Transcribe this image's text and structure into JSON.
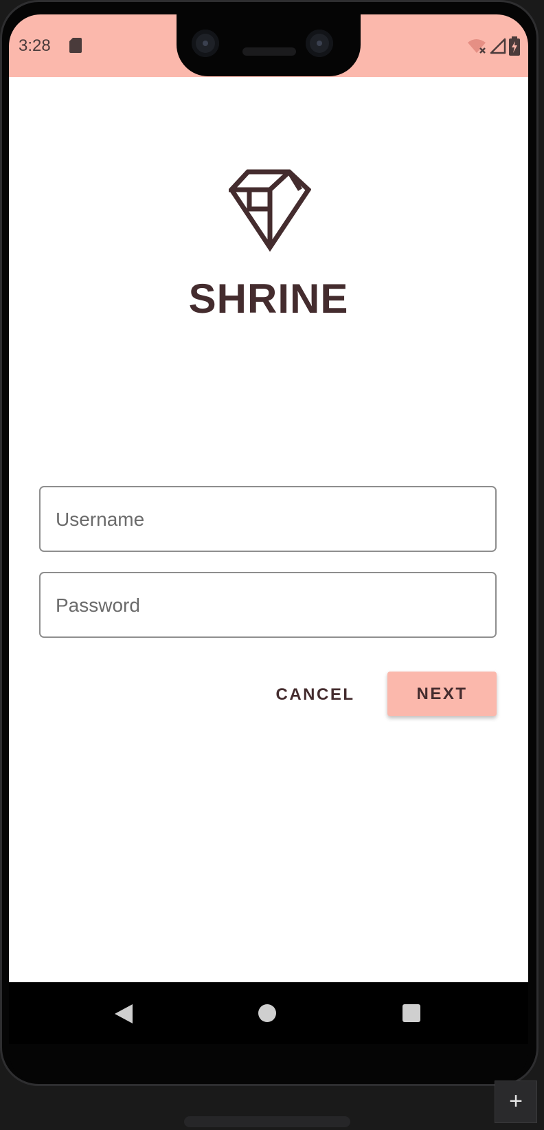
{
  "status_bar": {
    "time": "3:28",
    "background_color": "#fbb8ac",
    "icons": [
      "sd-card-icon",
      "wifi-off-icon",
      "cell-signal-icon",
      "battery-charging-icon"
    ]
  },
  "app": {
    "logo_icon": "diamond-icon",
    "title": "SHRINE",
    "brand_color": "#442c2e",
    "accent_color": "#fbb8ac"
  },
  "form": {
    "username_placeholder": "Username",
    "password_placeholder": "Password",
    "cancel_label": "CANCEL",
    "next_label": "NEXT"
  },
  "nav_bar": {
    "icons": [
      "back-icon",
      "home-icon",
      "recents-icon"
    ]
  },
  "emulator": {
    "plus_label": "+"
  }
}
